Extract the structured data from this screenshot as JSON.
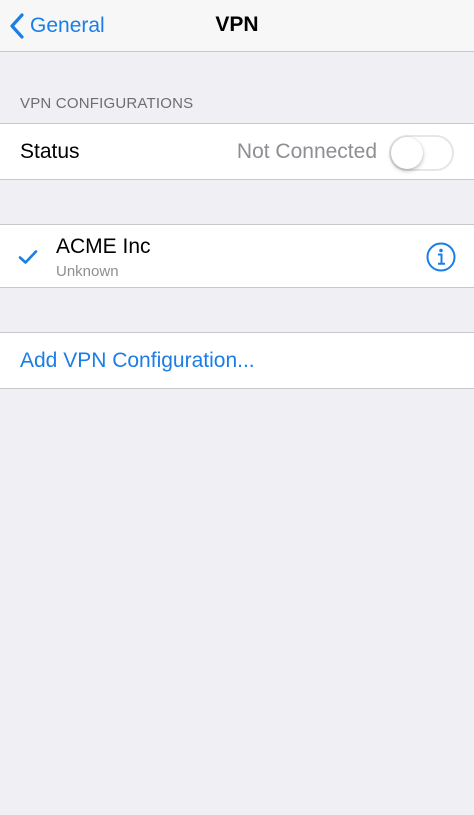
{
  "nav": {
    "back_label": "General",
    "title": "VPN"
  },
  "section": {
    "header": "VPN CONFIGURATIONS"
  },
  "status": {
    "label": "Status",
    "value": "Not Connected",
    "toggle_on": false
  },
  "vpn": {
    "name": "ACME Inc",
    "state": "Unknown",
    "selected": true
  },
  "add": {
    "label": "Add VPN Configuration..."
  },
  "colors": {
    "accent": "#1a7ee6",
    "background": "#efeff4",
    "secondary_text": "#8e8e93",
    "separator": "#c8c7cc"
  },
  "icons": {
    "back": "chevron-left-icon",
    "check": "checkmark-icon",
    "info": "info-icon"
  }
}
